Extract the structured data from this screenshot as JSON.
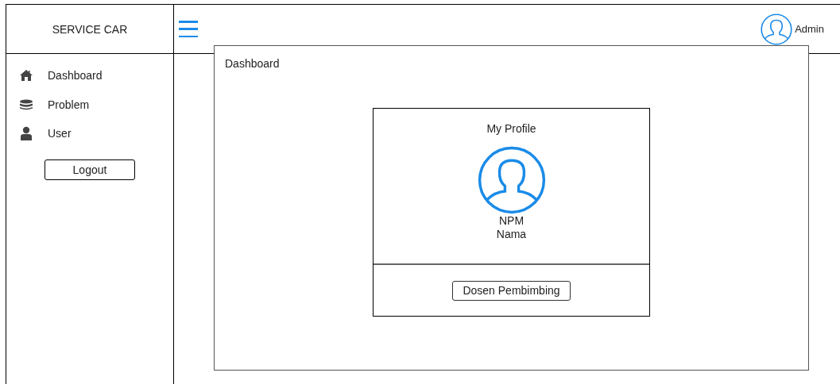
{
  "sidebar": {
    "title": "SERVICE CAR",
    "items": [
      {
        "label": "Dashboard"
      },
      {
        "label": "Problem"
      },
      {
        "label": "User"
      }
    ],
    "logout": "Logout"
  },
  "header": {
    "user": "Admin"
  },
  "panel": {
    "title": "Dashboard",
    "card": {
      "title": "My Profile",
      "lines": [
        "NPM",
        "Nama"
      ],
      "button": "Dosen Pembimbing"
    }
  }
}
